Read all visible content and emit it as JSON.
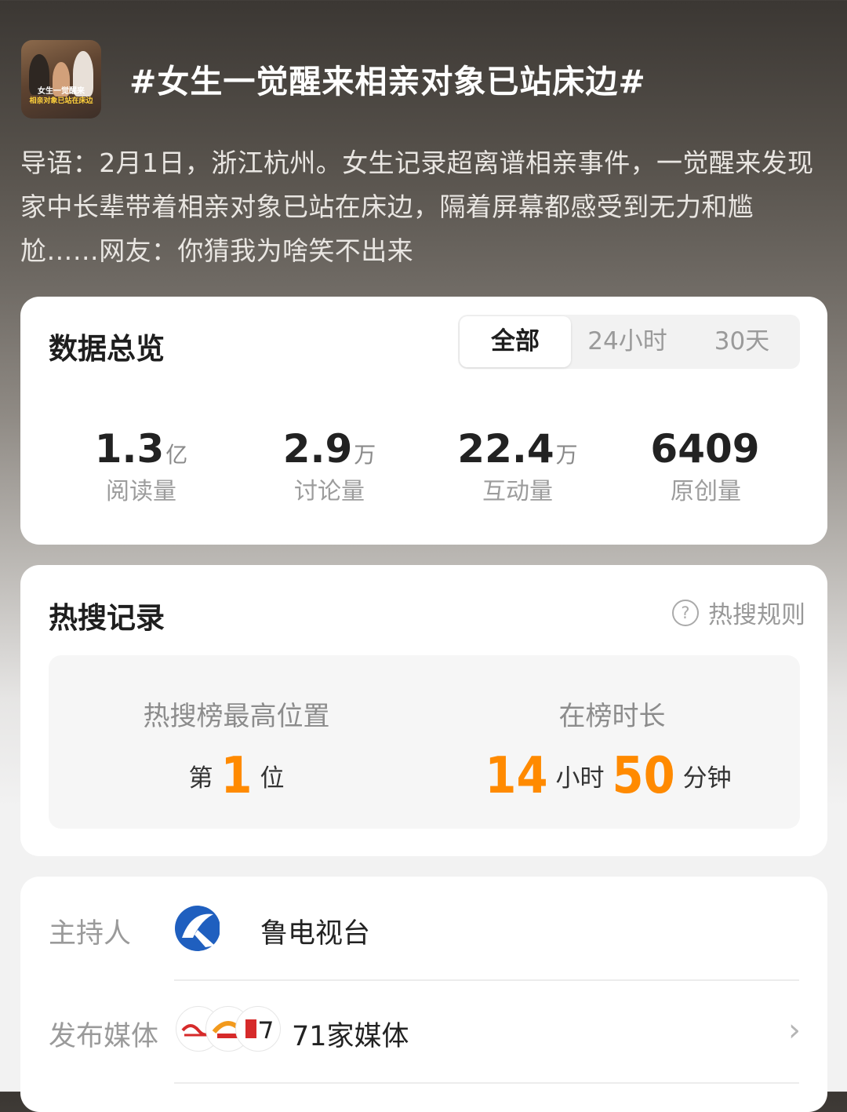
{
  "header": {
    "thumbnail_caption_1": "女生一觉醒来",
    "thumbnail_caption_2": "相亲对象已站在床边",
    "title": "#女生一觉醒来相亲对象已站床边#",
    "intro": "导语：2月1日，浙江杭州。女生记录超离谱相亲事件，一觉醒来发现家中长辈带着相亲对象已站在床边，隔着屏幕都感受到无力和尴尬……网友：你猜我为啥笑不出来"
  },
  "overview": {
    "title": "数据总览",
    "tabs": [
      "全部",
      "24小时",
      "30天"
    ],
    "selected_tab": "全部",
    "stats": [
      {
        "value": "1.3",
        "unit": "亿",
        "label": "阅读量"
      },
      {
        "value": "2.9",
        "unit": "万",
        "label": "讨论量"
      },
      {
        "value": "22.4",
        "unit": "万",
        "label": "互动量"
      },
      {
        "value": "6409",
        "unit": "",
        "label": "原创量"
      }
    ]
  },
  "hot_search": {
    "title": "热搜记录",
    "rules_label": "热搜规则",
    "rules_icon": "question-circle-icon",
    "highest_label": "热搜榜最高位置",
    "rank_prefix": "第",
    "rank": "1",
    "rank_suffix": "位",
    "duration_label": "在榜时长",
    "hours": "14",
    "hours_unit": "小时",
    "minutes": "50",
    "minutes_unit": "分钟",
    "accent_color": "#ff8a00"
  },
  "info": {
    "host_label": "主持人",
    "host_name": "鲁电视台",
    "media_label": "发布媒体",
    "media_text": "71家媒体",
    "chevron_icon": "chevron-right-icon"
  }
}
